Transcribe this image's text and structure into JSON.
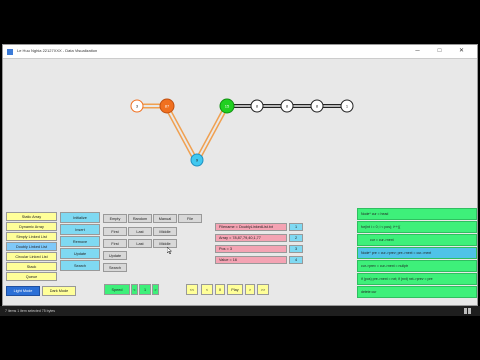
{
  "window": {
    "title": "Le Huu Nghia 22127XXX - Data Visualization",
    "minimize_glyph": "─",
    "maximize_glyph": "□",
    "close_glyph": "✕"
  },
  "graph": {
    "nodes": [
      {
        "id": "n0",
        "label": "3",
        "kind": "normal"
      },
      {
        "id": "n1",
        "label": "87",
        "kind": "orange"
      },
      {
        "id": "n2",
        "label": "9",
        "kind": "blue"
      },
      {
        "id": "n3",
        "label": "15",
        "kind": "green"
      },
      {
        "id": "n4",
        "label": "8",
        "kind": "normal"
      },
      {
        "id": "n5",
        "label": "8",
        "kind": "normal"
      },
      {
        "id": "n6",
        "label": "8",
        "kind": "normal"
      },
      {
        "id": "n7",
        "label": "1",
        "kind": "normal"
      }
    ]
  },
  "ds_menu": [
    "Static Array",
    "Dynamic Array",
    "Simply Linked List",
    "Doubly Linked List",
    "Circular Linked List",
    "Stack",
    "Queue"
  ],
  "ds_active": "Doubly Linked List",
  "actions": [
    "Initialize",
    "Insert",
    "Remove",
    "Update",
    "Search"
  ],
  "sub_rows": [
    [
      "Empty",
      "Random",
      "Manual",
      "File"
    ],
    [
      "First",
      "Last",
      "Middle"
    ],
    [
      "First",
      "Last",
      "Middle"
    ],
    [
      "Update"
    ],
    [
      "Search"
    ]
  ],
  "params": [
    {
      "label": "Filename = DoublyLinkedList.txt",
      "btn": "1"
    },
    {
      "label": "Array = 78,87,79,40,1,77",
      "btn": "2"
    },
    {
      "label": "Pos = 3",
      "btn": "3"
    },
    {
      "label": "Value = 16",
      "btn": "4"
    }
  ],
  "code_lines": [
    "Node* cur = head",
    "for(int i = 0; i < pos); i++){",
    "cur = cur->next",
    "Node* pre = cur->prev; pre->next = cur->next",
    "cur->prev = cur->next = nullptr",
    "if (pos) pre->next = nxt; if (nxt) nxt->prev = pre",
    "delete cur"
  ],
  "code_highlight": 3,
  "bottom": {
    "light_mode": "Light Mode",
    "dark_mode": "Dark Mode",
    "speed": "Speed",
    "speed_dec": "<",
    "speed_val": "1",
    "speed_inc": ">",
    "first": "<<",
    "prev": "<",
    "pause": "II",
    "play": "Play",
    "next": ">",
    "last": ">>"
  },
  "taskbar_text": "7 items   1 item selected  75 bytes",
  "colors": {
    "orange_node": "#f07020",
    "green_node": "#20d020",
    "blue_node": "#40c8f0",
    "orange_edge": "#f0a050"
  }
}
